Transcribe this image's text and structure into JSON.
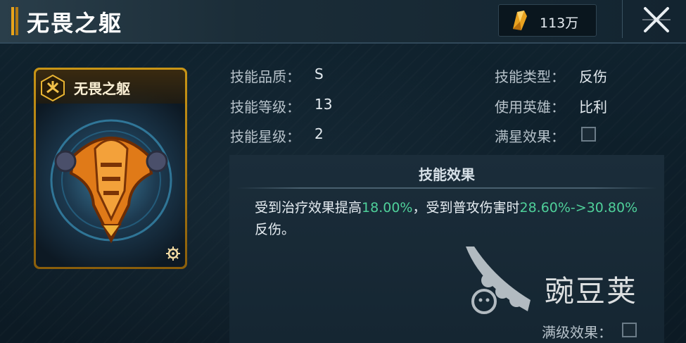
{
  "header": {
    "title": "无畏之躯",
    "currency_amount": "113万",
    "currency_icon": "feather-gem-icon",
    "close_icon": "close-x-icon"
  },
  "card": {
    "name": "无畏之躯",
    "badge_icon": "hexagon-badge-icon",
    "art": "orange-armor-art",
    "corner_icon": "gear-icon"
  },
  "info": {
    "quality_label": "技能品质：",
    "quality_value": "S",
    "level_label": "技能等级：",
    "level_value": "13",
    "star_label": "技能星级：",
    "star_value": "2",
    "type_label": "技能类型：",
    "type_value": "反伤",
    "hero_label": "使用英雄：",
    "hero_value": "比利",
    "max_star_label": "满星效果：",
    "max_star_checked": false
  },
  "effect": {
    "title": "技能效果",
    "text_part1": "受到治疗效果提高",
    "value1": "18.00%",
    "text_part2": "，受到普攻伤害时",
    "value2": "28.60%->30.80%",
    "text_part3": "反伤。",
    "max_level_label": "满级效果：",
    "max_level_checked": false
  },
  "watermark": {
    "text": "豌豆荚",
    "icon": "pea-pod-logo-icon"
  },
  "colors": {
    "accent_gold": "#e8a31b",
    "highlight_green": "#4fd09a",
    "background": "#0e1e29"
  }
}
